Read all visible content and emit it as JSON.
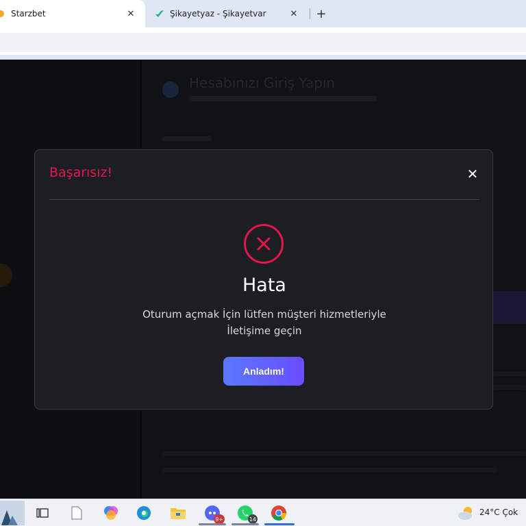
{
  "browser": {
    "tabs": [
      {
        "title": "Starzbet",
        "active": true,
        "close": "✕"
      },
      {
        "title": "Şikayetyaz - Şikayetvar",
        "active": false,
        "close": "✕"
      }
    ],
    "new_tab": "+"
  },
  "background_page": {
    "heading": "Hesabınızı Giriş Yapın"
  },
  "modal": {
    "title": "Başarısız!",
    "close_symbol": "✕",
    "heading": "Hata",
    "message_line1": "Oturum açmak İçin lütfen müşteri hizmetleriyle",
    "message_line2": "İletişime geçin",
    "button_label": "Anladım!",
    "colors": {
      "error": "#e5154d",
      "button_start": "#5a79ff",
      "button_end": "#6a4dff"
    }
  },
  "taskbar": {
    "icons": [
      "task-view-icon",
      "file-icon",
      "copilot-icon",
      "edge-icon",
      "file-explorer-icon",
      "discord-icon",
      "whatsapp-icon",
      "chrome-icon"
    ],
    "discord_badge": "9+",
    "whatsapp_badge": "14",
    "weather": "24°C  Çok"
  }
}
